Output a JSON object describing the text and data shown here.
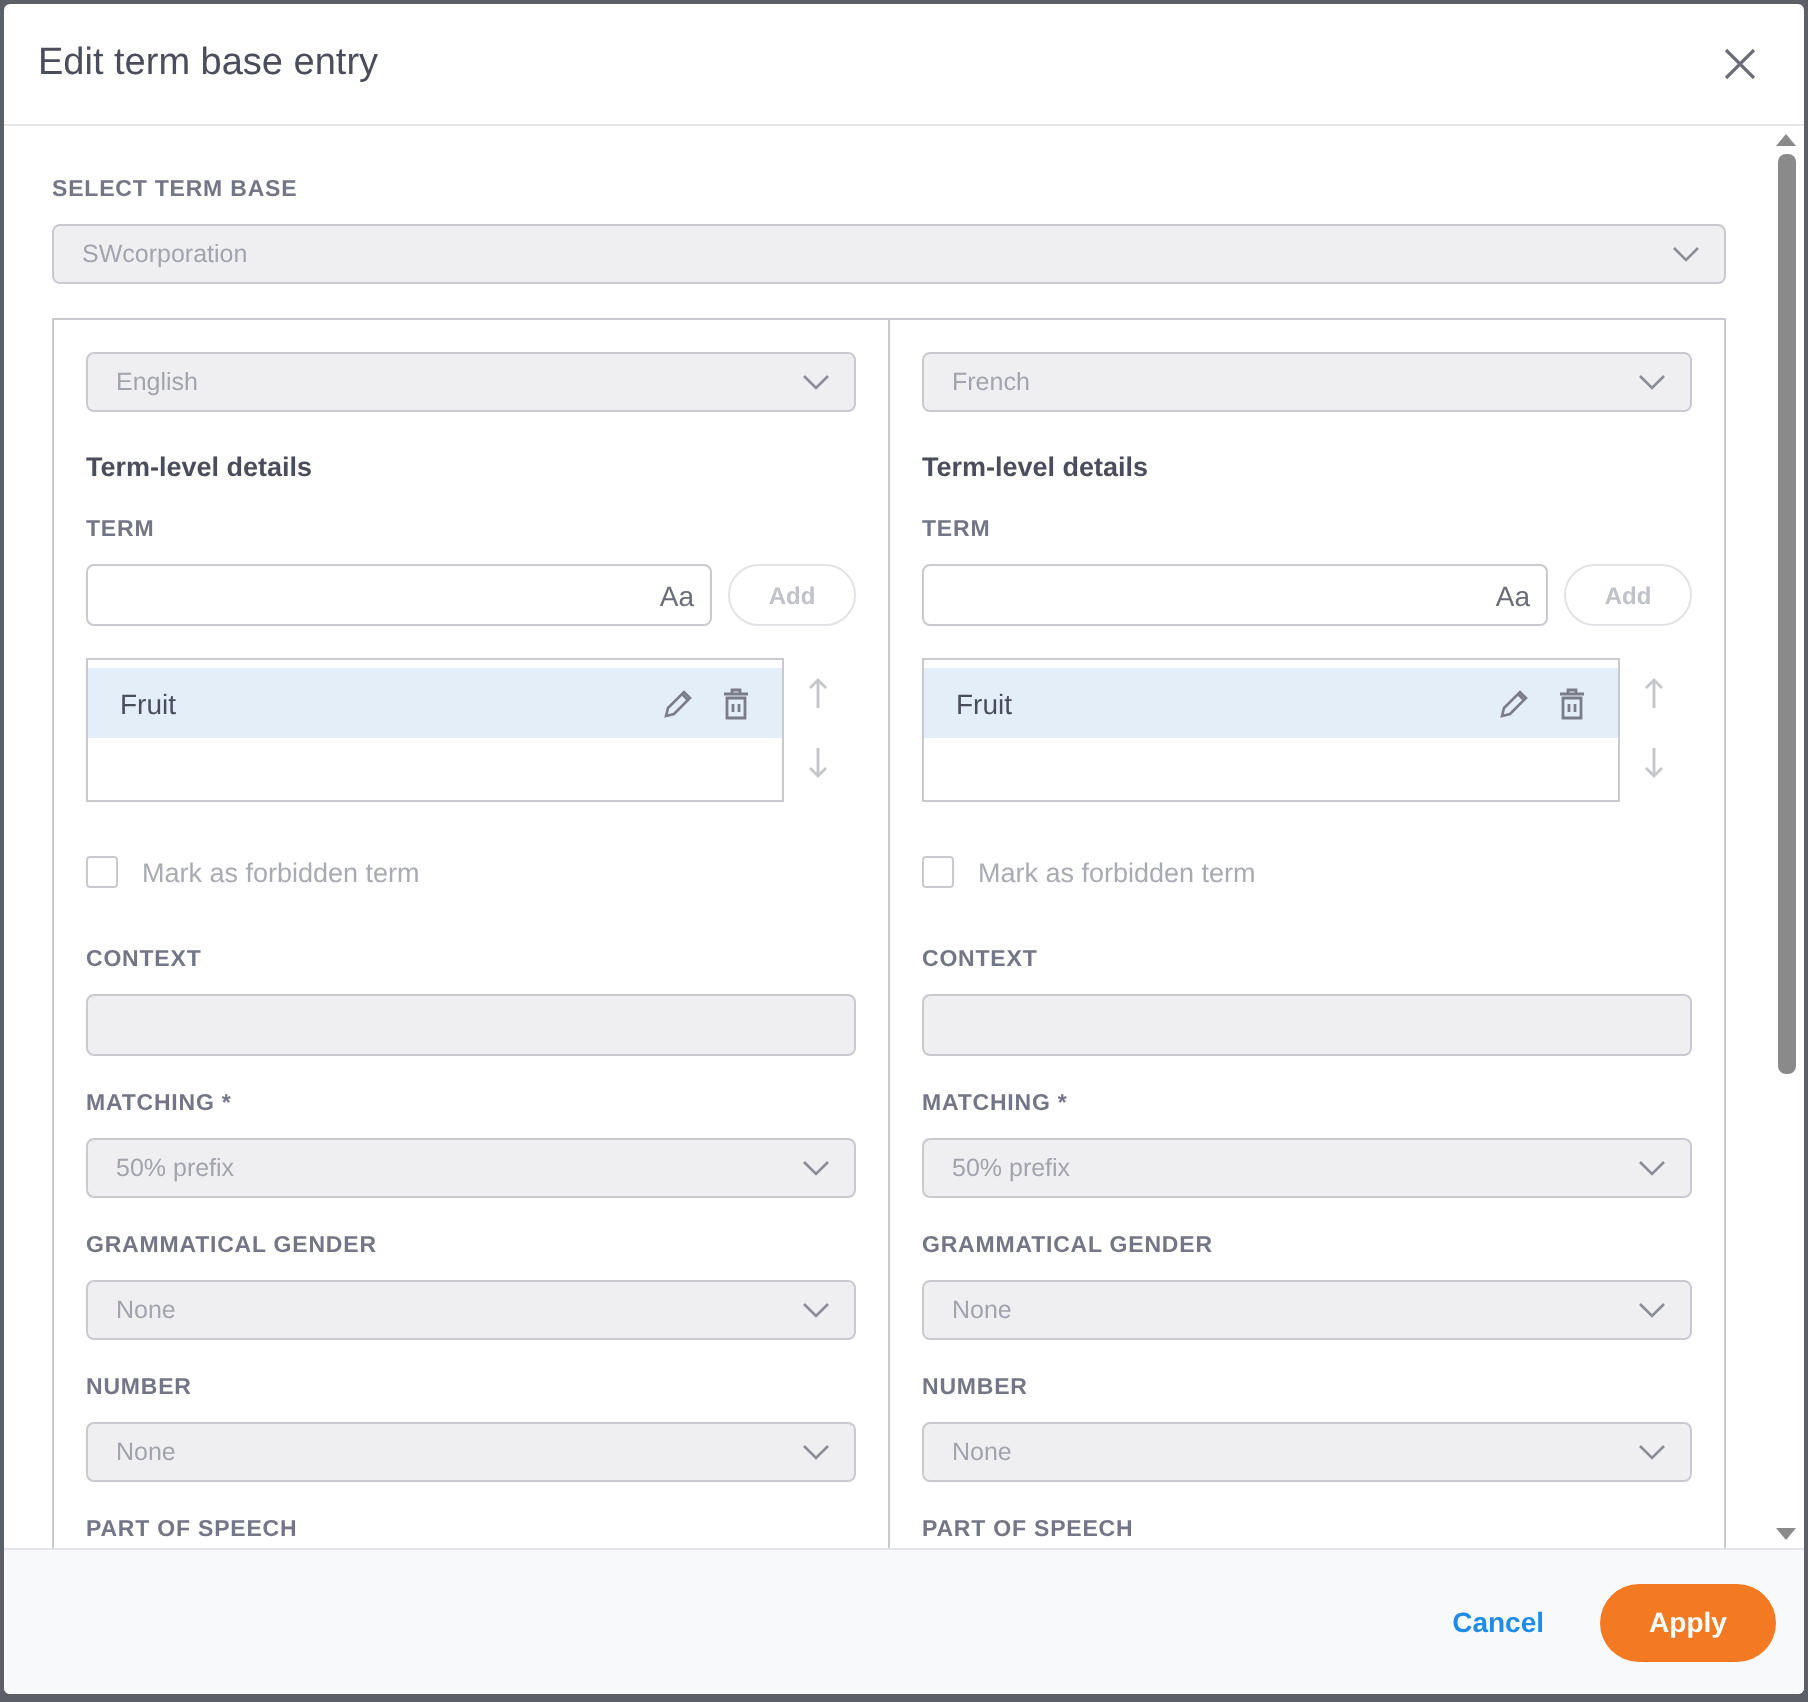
{
  "dialog": {
    "title": "Edit term base entry"
  },
  "term_base": {
    "label": "SELECT TERM BASE",
    "value": "SWcorporation"
  },
  "languages": [
    {
      "language": "English",
      "heading": "Term-level details",
      "term_label": "TERM",
      "term_input": {
        "placeholder_icon": "Aa"
      },
      "add_button": "Add",
      "terms": [
        {
          "text": "Fruit",
          "selected": true
        }
      ],
      "forbidden": {
        "label": "Mark as forbidden term",
        "checked": false
      },
      "fields": [
        {
          "kind": "text",
          "label": "CONTEXT"
        },
        {
          "kind": "select",
          "label": "MATCHING *",
          "value": "50% prefix"
        },
        {
          "kind": "select",
          "label": "GRAMMATICAL GENDER",
          "value": "None"
        },
        {
          "kind": "select",
          "label": "NUMBER",
          "value": "None"
        },
        {
          "kind": "label",
          "label": "PART OF SPEECH"
        }
      ]
    },
    {
      "language": "French",
      "heading": "Term-level details",
      "term_label": "TERM",
      "term_input": {
        "placeholder_icon": "Aa"
      },
      "add_button": "Add",
      "terms": [
        {
          "text": "Fruit",
          "selected": true
        }
      ],
      "forbidden": {
        "label": "Mark as forbidden term",
        "checked": false
      },
      "fields": [
        {
          "kind": "text",
          "label": "CONTEXT"
        },
        {
          "kind": "select",
          "label": "MATCHING *",
          "value": "50% prefix"
        },
        {
          "kind": "select",
          "label": "GRAMMATICAL GENDER",
          "value": "None"
        },
        {
          "kind": "select",
          "label": "NUMBER",
          "value": "None"
        },
        {
          "kind": "label",
          "label": "PART OF SPEECH"
        }
      ]
    }
  ],
  "footer": {
    "cancel": "Cancel",
    "apply": "Apply"
  }
}
